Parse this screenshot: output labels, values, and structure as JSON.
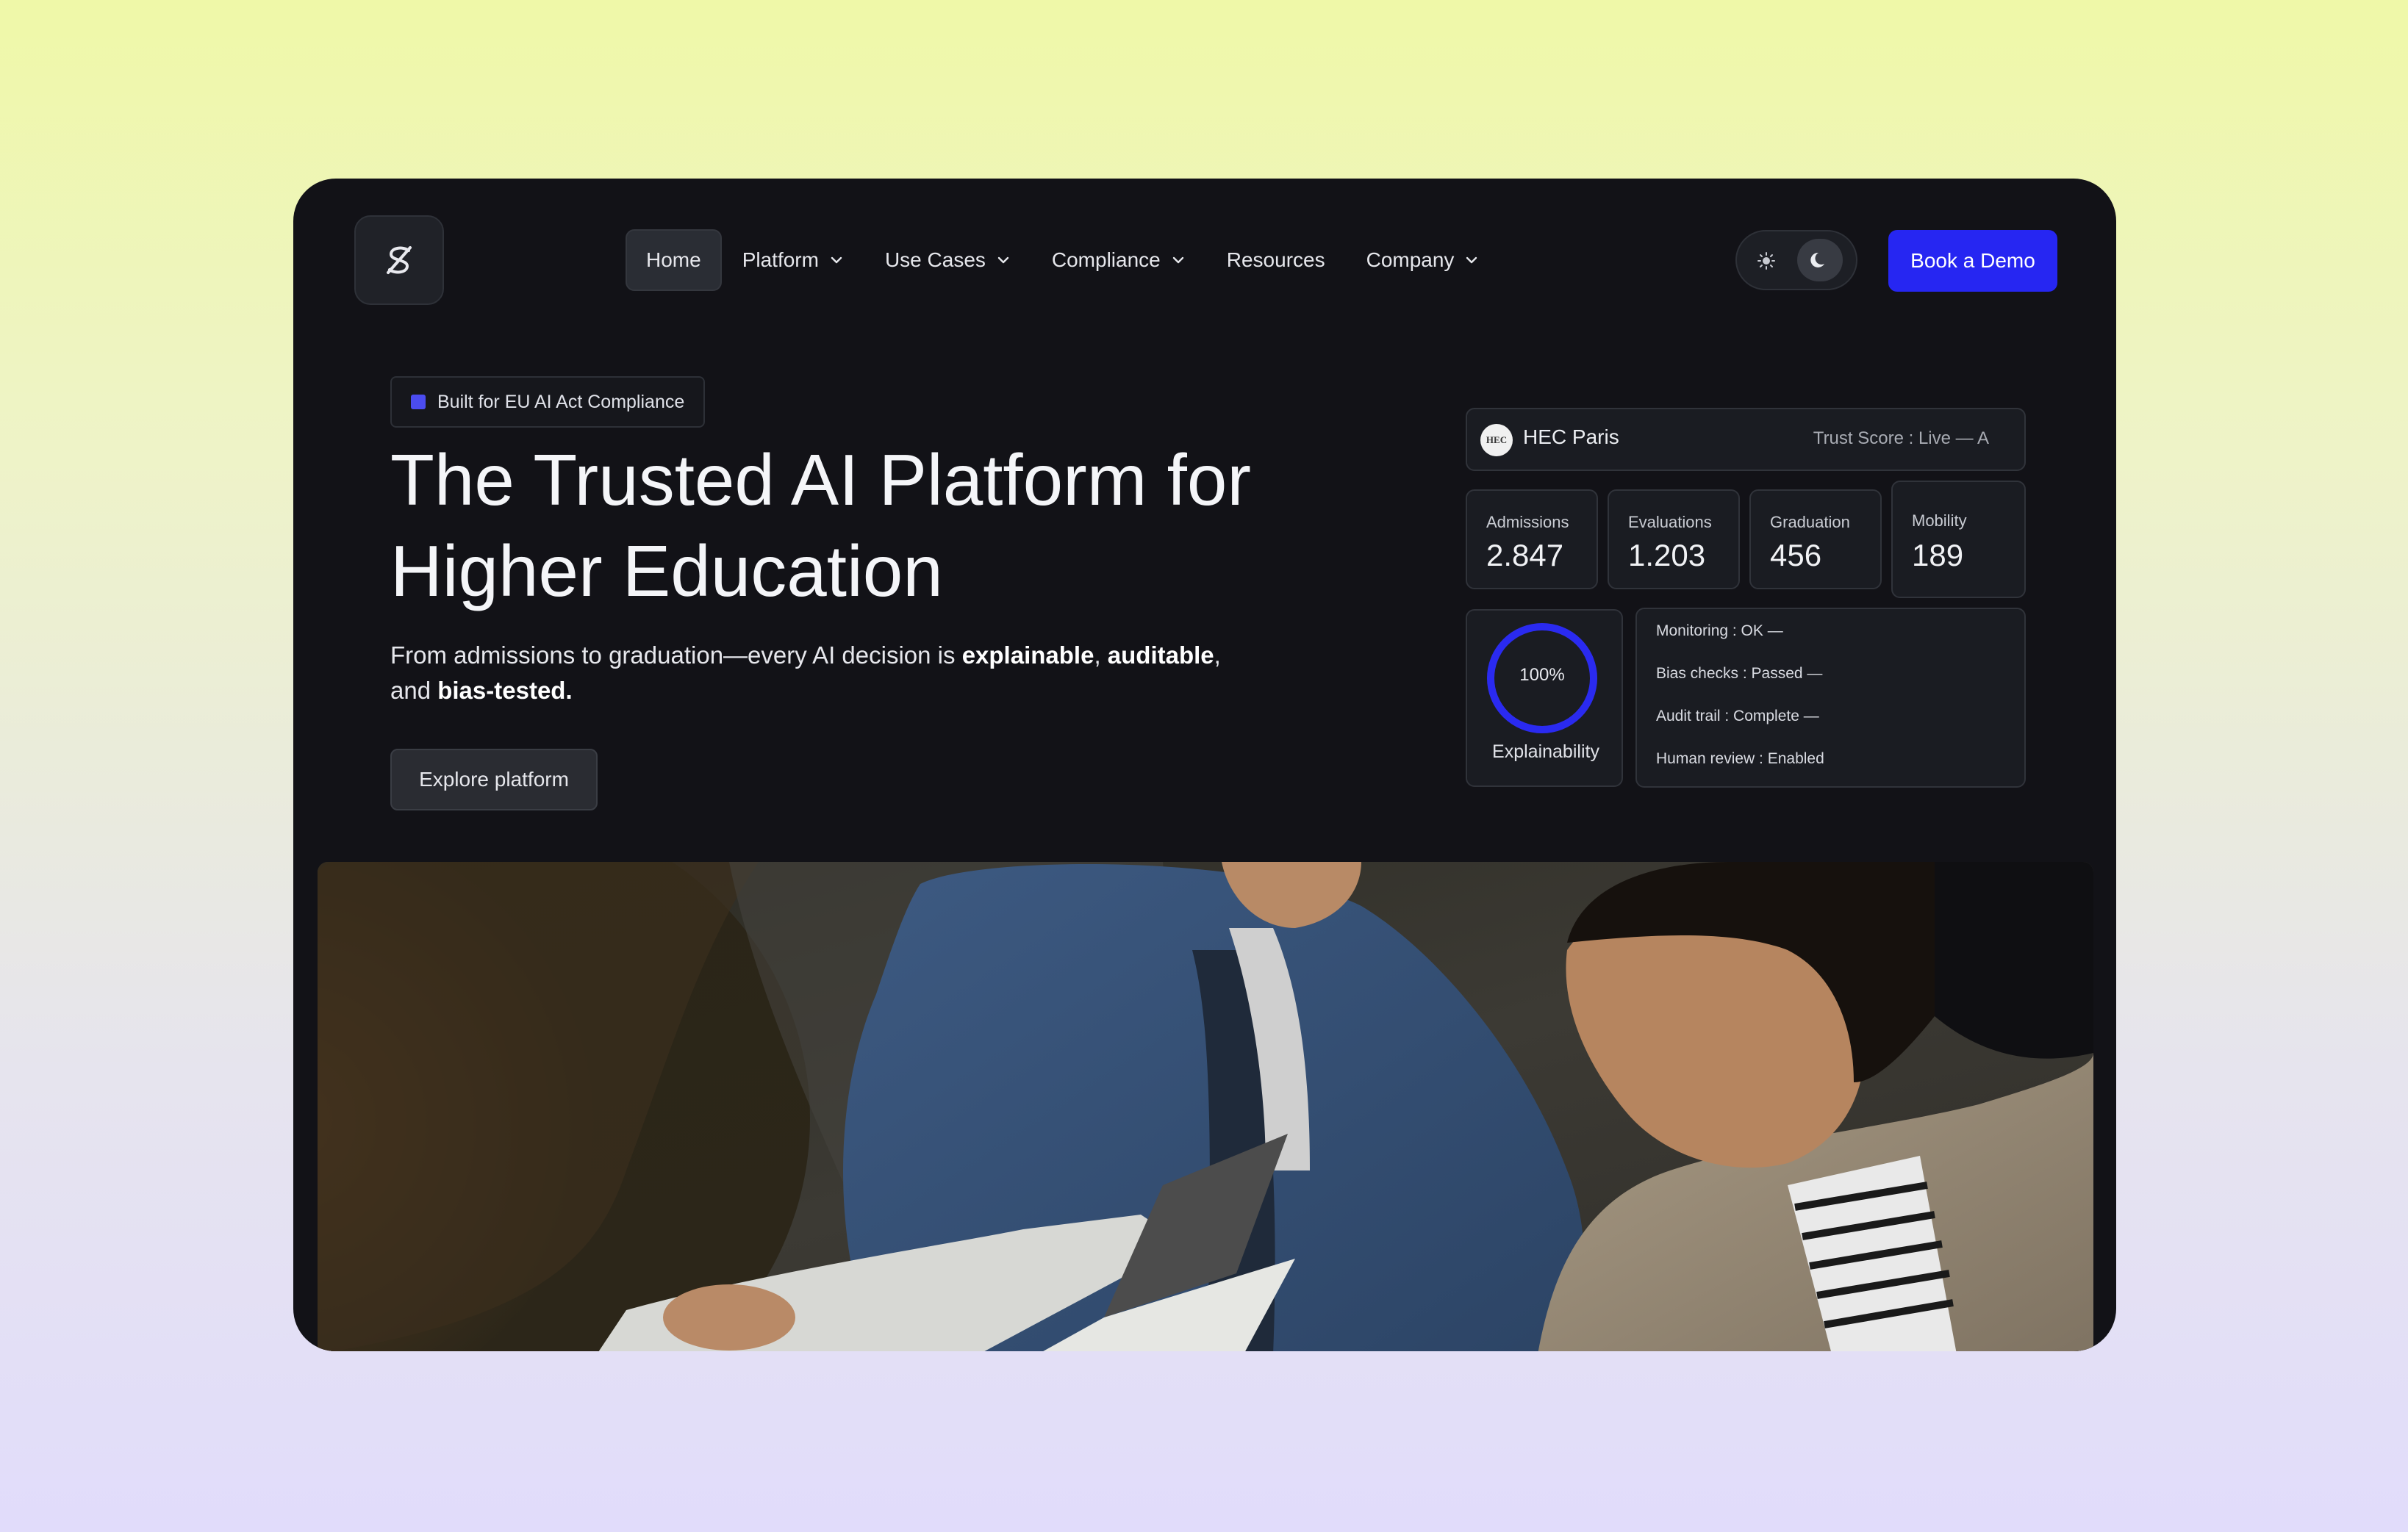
{
  "nav": {
    "items": [
      {
        "label": "Home",
        "active": true,
        "dropdown": false
      },
      {
        "label": "Platform",
        "active": false,
        "dropdown": true
      },
      {
        "label": "Use Cases",
        "active": false,
        "dropdown": true
      },
      {
        "label": "Compliance",
        "active": false,
        "dropdown": true
      },
      {
        "label": "Resources",
        "active": false,
        "dropdown": false
      },
      {
        "label": "Company",
        "active": false,
        "dropdown": true
      }
    ],
    "cta": "Book a Demo",
    "theme": "dark"
  },
  "hero": {
    "badge": "Built for EU AI Act Compliance",
    "title_line1": "The Trusted AI Platform for",
    "title_line2": "Higher Education",
    "sub_part1": "From admissions to graduation—every AI decision is ",
    "sub_bold1": "explainable",
    "sub_comma": ", ",
    "sub_bold2": "auditable",
    "sub_part2": ",",
    "sub_part3": "and ",
    "sub_bold3": "bias-tested.",
    "button": "Explore platform"
  },
  "dashboard": {
    "school_logo_text": "HEC",
    "school": "HEC Paris",
    "trust_score": "Trust Score : Live — A",
    "stats": [
      {
        "label": "Admissions",
        "value": "2.847"
      },
      {
        "label": "Evaluations",
        "value": "1.203"
      },
      {
        "label": "Graduation",
        "value": "456"
      },
      {
        "label": "Mobility",
        "value": "189"
      }
    ],
    "explainability_pct": "100%",
    "explainability_fraction": 1.0,
    "explainability_label": "Explainability",
    "checks": [
      "Monitoring : OK —",
      "Bias checks : Passed —",
      "Audit trail : Complete —",
      "Human review : Enabled"
    ]
  },
  "colors": {
    "accent": "#2626f2",
    "window_bg": "#121217",
    "ring": "#2a2af0"
  }
}
